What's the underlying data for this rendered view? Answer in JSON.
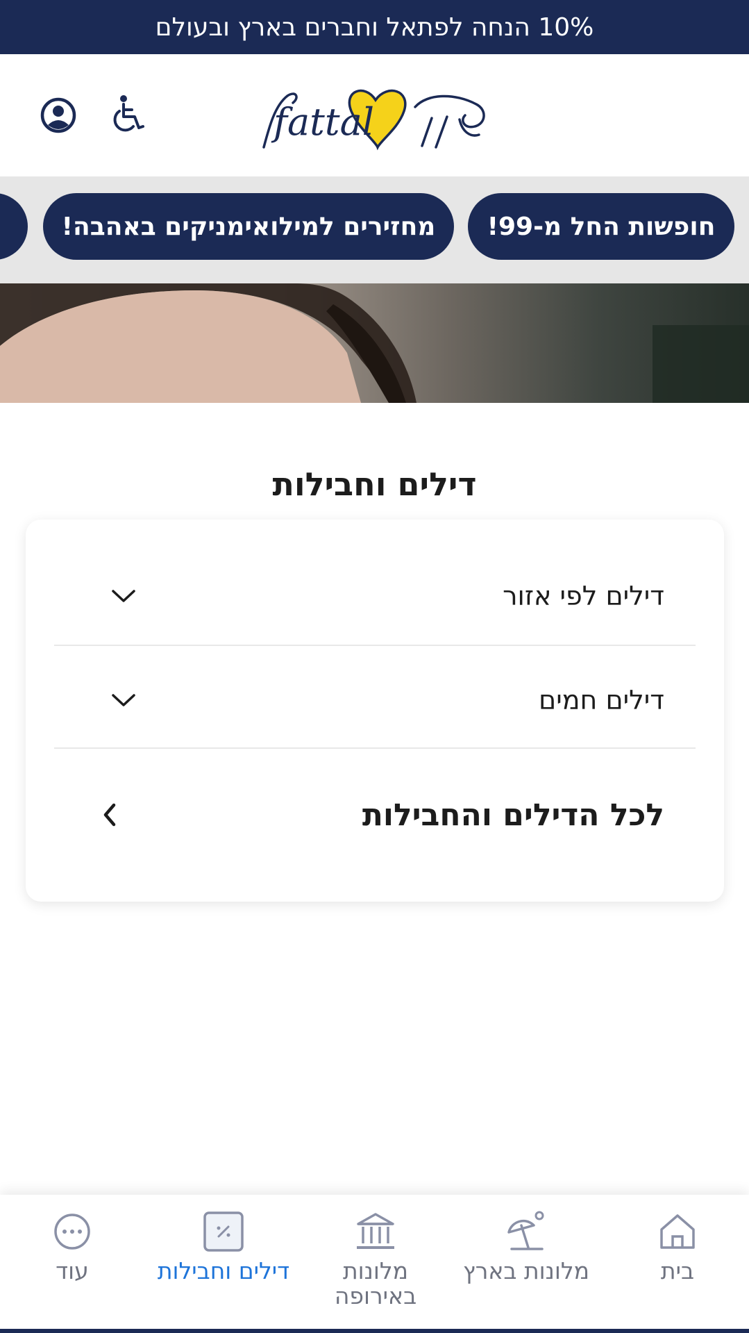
{
  "promo_bar": {
    "text": "10% הנחה לפתאל וחברים בארץ ובעולם"
  },
  "header": {
    "logo_text": "fattal",
    "icons": [
      "user-account-icon",
      "accessibility-icon"
    ]
  },
  "chips": [
    {
      "label": "חופשות החל מ-99!"
    },
    {
      "label": "מחזירים למילואימניקים באהבה!"
    }
  ],
  "deals": {
    "title": "דילים וחבילות",
    "items": [
      {
        "label": "דילים לפי אזור",
        "icon": "chevron-down-icon"
      },
      {
        "label": "דילים חמים",
        "icon": "chevron-down-icon"
      },
      {
        "label": "לכל הדילים והחבילות",
        "icon": "chevron-left-icon"
      }
    ]
  },
  "bottom_nav": {
    "items": [
      {
        "label": "בית",
        "icon": "home-icon"
      },
      {
        "label": "מלונות בארץ",
        "icon": "beach-umbrella-icon"
      },
      {
        "label": "מלונות באירופה",
        "icon": "bank-building-icon"
      },
      {
        "label": "דילים וחבילות",
        "icon": "percent-tag-icon",
        "active": true
      },
      {
        "label": "עוד",
        "icon": "more-dots-icon"
      }
    ]
  },
  "colors": {
    "brand_navy": "#1b2a55",
    "active_blue": "#1e74d9",
    "logo_yellow": "#f5d21a"
  }
}
